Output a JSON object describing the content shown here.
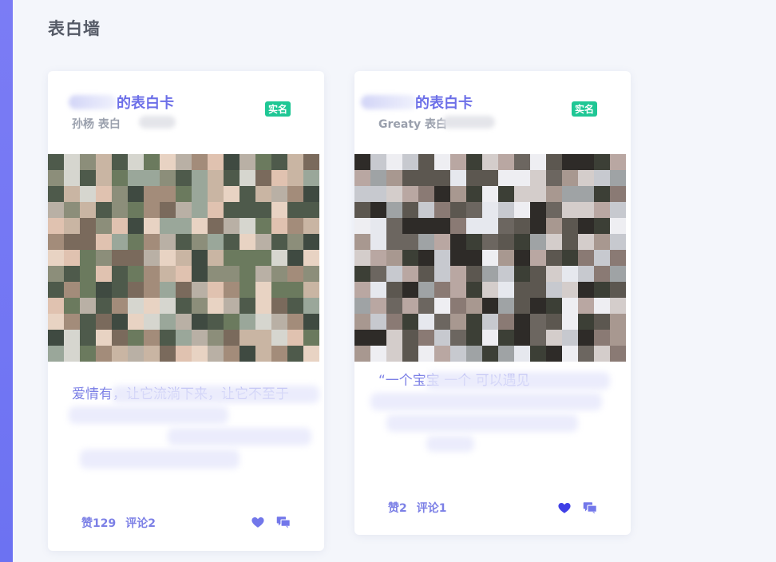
{
  "page": {
    "title": "表白墙"
  },
  "cards": [
    {
      "title": "的表白卡",
      "subtitle": "孙杨 表白",
      "badge": "实名",
      "text": "爱情有，让它流淌下来，让它不至于",
      "likes": "赞129",
      "comments": "评论2"
    },
    {
      "title": "的表白卡",
      "subtitle": "Greaty 表白",
      "badge": "实名",
      "text": "“一个宝宝 一个 可以遇见",
      "likes": "赞2",
      "comments": "评论1"
    }
  ],
  "icons": {
    "like": "heart-icon",
    "comment": "chat-bubbles-icon"
  },
  "colors": {
    "accent": "#6c6fe8",
    "badge": "#1fc795",
    "sidebar": "#7b7cf5"
  }
}
